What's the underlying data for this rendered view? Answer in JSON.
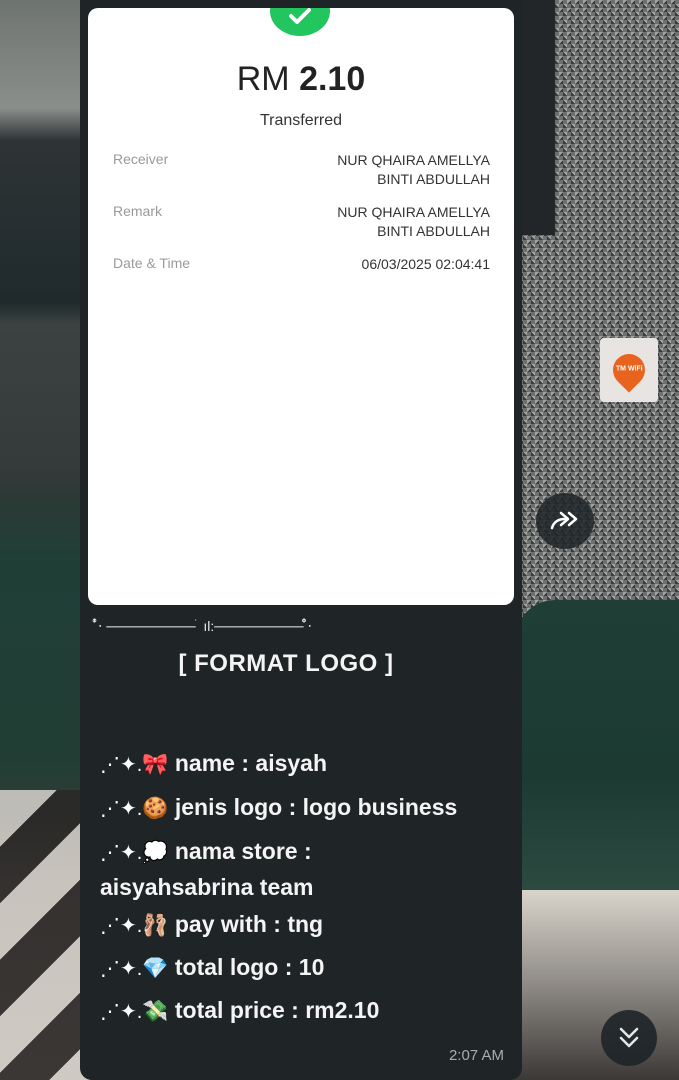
{
  "receipt": {
    "currency": "RM",
    "amount": "2.10",
    "status": "Transferred",
    "rows": [
      {
        "label": "Receiver",
        "value_line1": "NUR QHAIRA AMELLYA",
        "value_line2": "BINTI ABDULLAH"
      },
      {
        "label": "Remark",
        "value_line1": "NUR QHAIRA AMELLYA",
        "value_line2": "BINTI ABDULLAH"
      },
      {
        "label": "Date & Time",
        "value_line1": "06/03/2025 02:04:41",
        "value_line2": ""
      }
    ],
    "accent_color": "#22c55e"
  },
  "caption": {
    "divider": "‧̍̊ ───────── ׄ ıl׃ ───────── ‧̍̊",
    "format_title": "[ FORMAT LOGO ]",
    "sparkle": "⋰✦.",
    "items": [
      {
        "emoji": "🎀",
        "text": "name : aisyah"
      },
      {
        "emoji": "🍪",
        "text": "jenis logo : logo business"
      },
      {
        "emoji": "💭",
        "text": "nama store :",
        "continuation": "aisyahsabrina team"
      },
      {
        "emoji": "🩰",
        "text": "pay with : tng"
      },
      {
        "emoji": "💎",
        "text": "total logo : 10"
      },
      {
        "emoji": "💸",
        "text": "total price : rm2.10"
      }
    ],
    "time": "2:07 AM"
  },
  "background": {
    "wifi_sign": "TM WiFi"
  },
  "icons": {
    "forward": "forward-icon",
    "scroll_down": "double-chevron-down-icon"
  }
}
